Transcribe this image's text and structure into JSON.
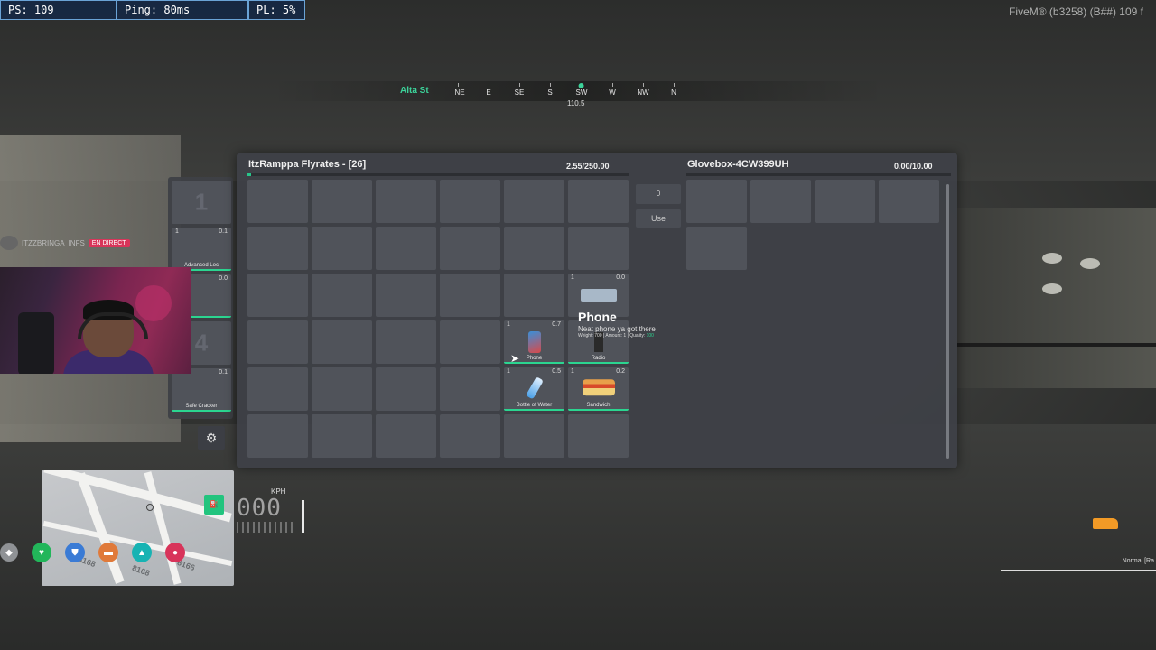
{
  "netgraph": {
    "fps": "PS: 109",
    "ping": "Ping: 80ms",
    "pl": "PL: 5%"
  },
  "client": {
    "label": "FiveM® (b3258) (B##) 109 f"
  },
  "compass": {
    "street": "Alta St",
    "directions": [
      "NE",
      "E",
      "SE",
      "S",
      "SW",
      "W",
      "NW",
      "N"
    ],
    "active": "SW",
    "heading": "110.5"
  },
  "player_inventory": {
    "title": "ItzRamppa Flyrates - [26]",
    "weight": "2.55/250.00",
    "weight_fraction": 0.0102,
    "items": [
      {
        "slot": 16,
        "name": "",
        "qty": "1",
        "weight": "0.0",
        "icon": "radio-box-icon"
      },
      {
        "slot": 21,
        "name": "Phone",
        "qty": "1",
        "weight": "0.7",
        "icon": "phone-icon"
      },
      {
        "slot": 22,
        "name": "Radio",
        "qty": "",
        "weight": "",
        "icon": "radio-icon"
      },
      {
        "slot": 27,
        "name": "Bottle of Water",
        "qty": "1",
        "weight": "0.5",
        "icon": "water-bottle-icon"
      },
      {
        "slot": 28,
        "name": "Sandwich",
        "qty": "1",
        "weight": "0.2",
        "icon": "sandwich-icon"
      }
    ]
  },
  "controls": {
    "amount": "0",
    "use": "Use"
  },
  "glovebox": {
    "title": "Glovebox-4CW399UH",
    "weight": "0.00/10.00",
    "weight_fraction": 0.0
  },
  "hotbar": [
    {
      "num": "1",
      "name": "",
      "qty": "",
      "weight": ""
    },
    {
      "num": "",
      "name": "Advanced Loc",
      "qty": "1",
      "weight": "0.1"
    },
    {
      "num": "",
      "name": "",
      "qty": "",
      "weight": "0.0"
    },
    {
      "num": "4",
      "name": "",
      "qty": "",
      "weight": ""
    },
    {
      "num": "",
      "name": "Safe Cracker",
      "qty": "1",
      "weight": "0.1"
    }
  ],
  "tooltip": {
    "name": "Phone",
    "desc": "Neat phone ya got there",
    "meta": "Weight: 700 | Amount: 1 | Quality:",
    "quality": "100"
  },
  "stream": {
    "chat_user": "ITZZBRINGA",
    "chat_tag": "INFS",
    "live_badge": "EN DIRECT"
  },
  "minimap": {
    "labels": [
      "8168",
      "8168",
      "8166"
    ]
  },
  "status_icons": [
    {
      "icon": "health-heart-icon",
      "color": "#22b65a"
    },
    {
      "icon": "armor-shield-icon",
      "color": "#3a7bd5"
    },
    {
      "icon": "hunger-icon",
      "color": "#e07a3a"
    },
    {
      "icon": "thirst-icon",
      "color": "#17b3b3"
    },
    {
      "icon": "stress-icon",
      "color": "#d8345a"
    }
  ],
  "speedometer": {
    "unit": "KPH",
    "value": "000"
  },
  "voice": {
    "label": "Normal [Ra"
  },
  "colors": {
    "accent": "#2bd590",
    "panel": "#3e4046",
    "slot": "#50535a",
    "weapon": "#f29a26"
  }
}
